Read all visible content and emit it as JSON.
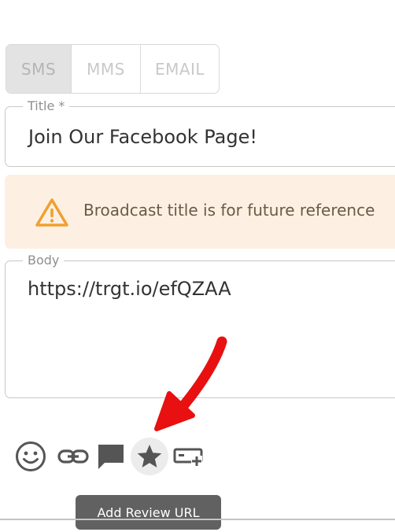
{
  "channel_tabs": [
    {
      "label": "SMS",
      "selected": true
    },
    {
      "label": "MMS",
      "selected": false
    },
    {
      "label": "EMAIL",
      "selected": false
    }
  ],
  "title_field": {
    "label": "Title *",
    "value": "Join Our Facebook Page!"
  },
  "alert": {
    "icon": "warning-triangle-icon",
    "text": "Broadcast title is for future reference",
    "accent_color": "#f0a030",
    "background_color": "#fdf0e3"
  },
  "body_field": {
    "label": "Body",
    "value": "https://trgt.io/efQZAA"
  },
  "toolbar": {
    "icons": [
      "emoji-icon",
      "link-icon",
      "comment-icon",
      "star-icon",
      "shortcode-icon"
    ]
  },
  "tooltip": {
    "text": "Add Review URL"
  },
  "annotation": {
    "arrow_color": "#e81010"
  }
}
